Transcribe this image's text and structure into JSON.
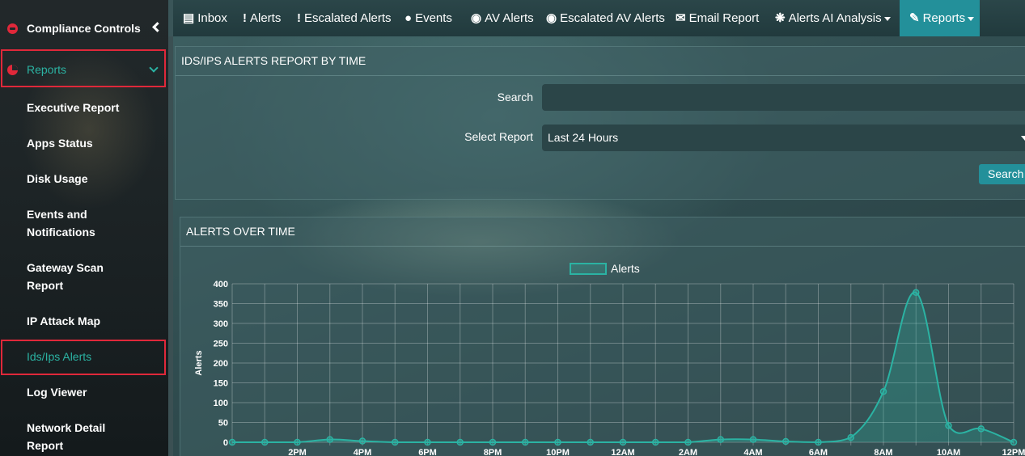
{
  "sidebar": {
    "header_items": [
      {
        "label": "Compliance Controls",
        "icon": "compliance-icon"
      },
      {
        "label": "Reports",
        "icon": "pie-chart-icon"
      }
    ],
    "sub_items": [
      {
        "label": "Executive Report"
      },
      {
        "label": "Apps Status"
      },
      {
        "label": "Disk Usage"
      },
      {
        "label": "Events and Notifications"
      },
      {
        "label": "Gateway Scan Report"
      },
      {
        "label": "IP Attack Map"
      },
      {
        "label": "Ids/Ips Alerts"
      },
      {
        "label": "Log Viewer"
      },
      {
        "label": "Network Detail Report"
      }
    ]
  },
  "topnav": {
    "items": [
      {
        "label": "Inbox",
        "icon": "inbox-icon"
      },
      {
        "label": "Alerts",
        "icon": "exclamation-icon"
      },
      {
        "label": "Escalated Alerts",
        "icon": "exclamation-icon"
      },
      {
        "label": "Events",
        "icon": "exclamation-circle-icon"
      },
      {
        "label": "AV Alerts",
        "icon": "shield-icon"
      },
      {
        "label": "Escalated AV Alerts",
        "icon": "shield-icon"
      },
      {
        "label": "Email Report",
        "icon": "envelope-icon"
      },
      {
        "label": "Alerts AI Analysis",
        "icon": "gear-icon"
      },
      {
        "label": "Reports",
        "icon": "pencil-icon"
      }
    ]
  },
  "report_panel": {
    "title": "IDS/IPS ALERTS REPORT BY TIME",
    "search_label": "Search",
    "search_value": "",
    "select_label": "Select Report",
    "select_value": "Last 24 Hours",
    "search_button": "Search"
  },
  "chart_panel": {
    "title": "ALERTS OVER TIME"
  },
  "colors": {
    "accent": "#23909a",
    "line": "#2bb3a3",
    "highlight_box": "#e0283a"
  },
  "chart_data": {
    "type": "area",
    "title": "",
    "xlabel": "",
    "ylabel": "Alerts",
    "legend": "top-center",
    "grid": true,
    "ylim": [
      0,
      400
    ],
    "yticks": [
      "0",
      "50",
      "100",
      "150",
      "200",
      "250",
      "300",
      "350",
      "400"
    ],
    "xticks": [
      "2PM",
      "4PM",
      "6PM",
      "8PM",
      "10PM",
      "12AM",
      "2AM",
      "4AM",
      "6AM",
      "8AM",
      "10AM",
      "12PM"
    ],
    "series": [
      {
        "name": "Alerts",
        "x": [
          "12PM",
          "1PM",
          "2PM",
          "3PM",
          "4PM",
          "5PM",
          "6PM",
          "7PM",
          "8PM",
          "9PM",
          "10PM",
          "11PM",
          "12AM",
          "1AM",
          "2AM",
          "3AM",
          "4AM",
          "5AM",
          "6AM",
          "7AM",
          "8AM",
          "9AM",
          "10AM",
          "11AM",
          "12PM"
        ],
        "values": [
          0,
          0,
          0,
          7,
          3,
          0,
          0,
          0,
          0,
          0,
          0,
          0,
          0,
          0,
          0,
          7,
          7,
          2,
          0,
          12,
          128,
          378,
          42,
          34,
          0
        ]
      }
    ]
  }
}
